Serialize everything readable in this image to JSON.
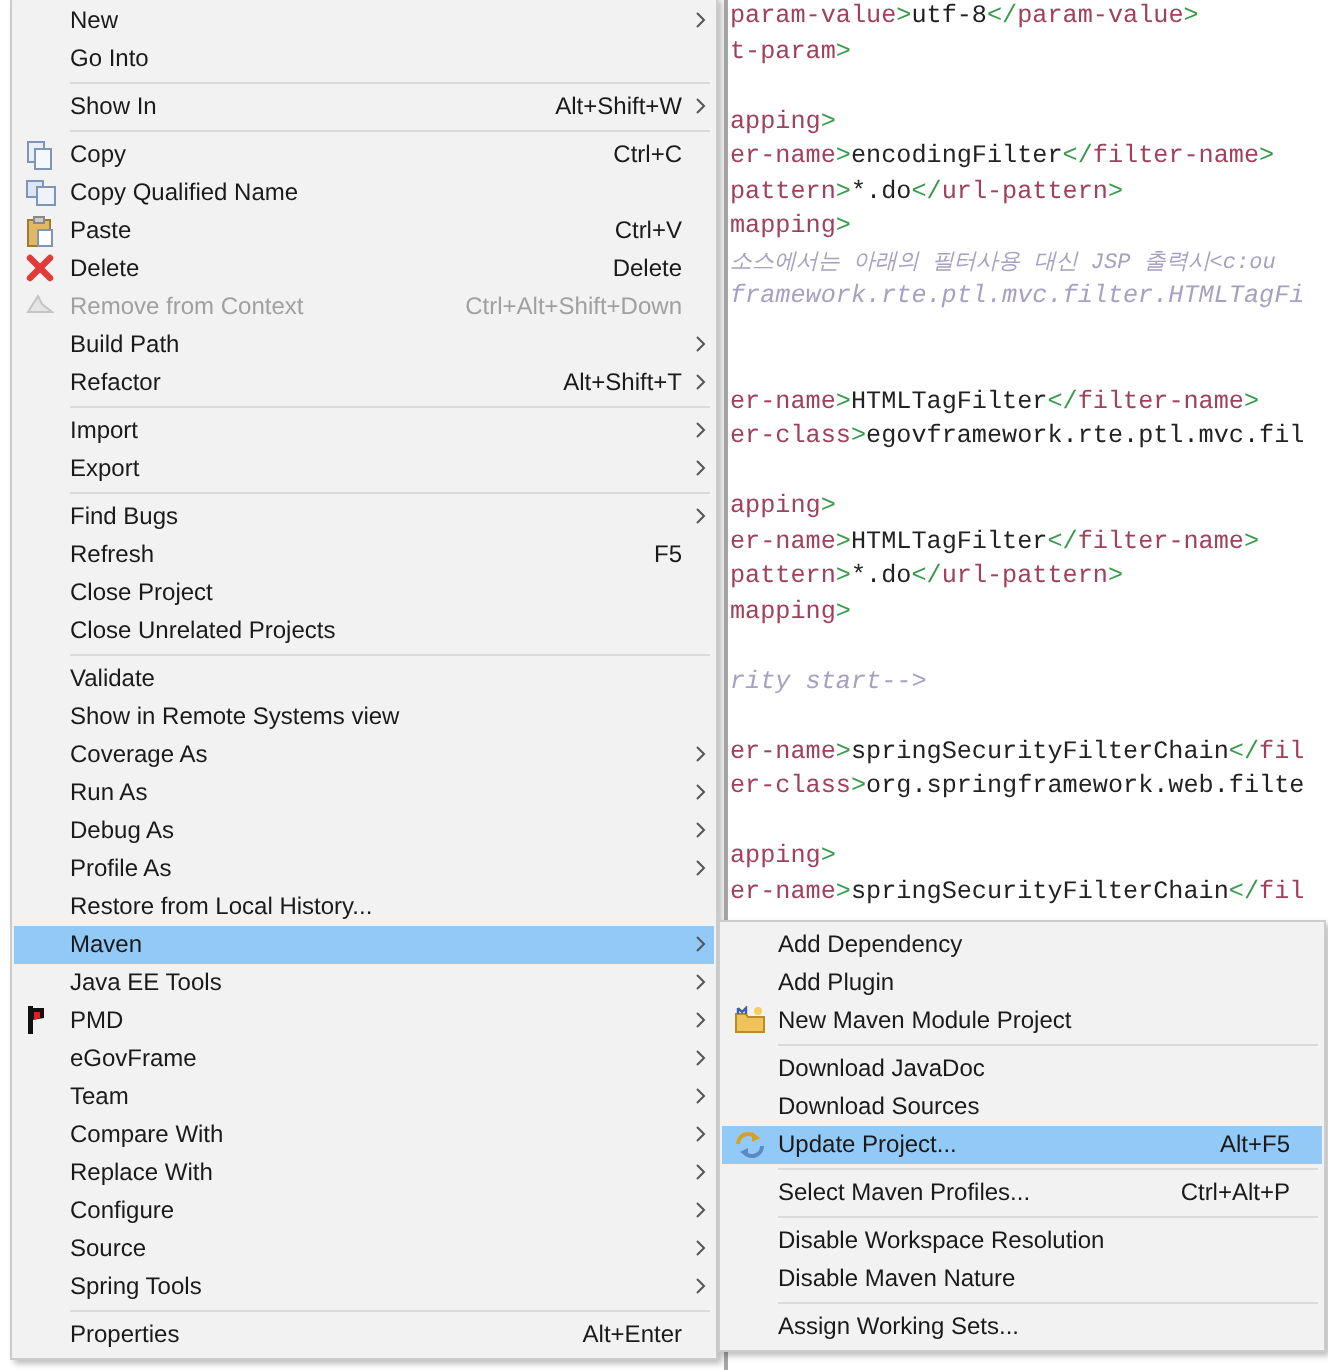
{
  "editor": {
    "lines": [
      {
        "kind": "code",
        "segments": [
          {
            "kind": "tag",
            "text": "param-value"
          },
          {
            "kind": "bracket",
            "text": ">"
          },
          {
            "kind": "text",
            "text": "utf-8"
          },
          {
            "kind": "bracket",
            "text": "</"
          },
          {
            "kind": "tag",
            "text": "param-value"
          },
          {
            "kind": "bracket",
            "text": ">"
          }
        ]
      },
      {
        "kind": "code",
        "segments": [
          {
            "kind": "tag",
            "text": "t-param"
          },
          {
            "kind": "bracket",
            "text": ">"
          }
        ]
      },
      {
        "kind": "blank"
      },
      {
        "kind": "code",
        "segments": [
          {
            "kind": "tag",
            "text": "apping"
          },
          {
            "kind": "bracket",
            "text": ">"
          }
        ]
      },
      {
        "kind": "code",
        "segments": [
          {
            "kind": "tag",
            "text": "er-name"
          },
          {
            "kind": "bracket",
            "text": ">"
          },
          {
            "kind": "text",
            "text": "encodingFilter"
          },
          {
            "kind": "bracket",
            "text": "</"
          },
          {
            "kind": "tag",
            "text": "filter-name"
          },
          {
            "kind": "bracket",
            "text": ">"
          }
        ]
      },
      {
        "kind": "code",
        "segments": [
          {
            "kind": "tag",
            "text": "pattern"
          },
          {
            "kind": "bracket",
            "text": ">"
          },
          {
            "kind": "text",
            "text": "*.do"
          },
          {
            "kind": "bracket",
            "text": "</"
          },
          {
            "kind": "tag",
            "text": "url-pattern"
          },
          {
            "kind": "bracket",
            "text": ">"
          }
        ]
      },
      {
        "kind": "code",
        "segments": [
          {
            "kind": "tag",
            "text": "mapping"
          },
          {
            "kind": "bracket",
            "text": ">"
          }
        ]
      },
      {
        "kind": "code",
        "segments": [
          {
            "kind": "hangul_comment",
            "text": "소스에서는 아래의 필터사용 대신 JSP 출력시<c:ou"
          }
        ]
      },
      {
        "kind": "code",
        "segments": [
          {
            "kind": "comment",
            "text": "framework.rte.ptl.mvc.filter.HTMLTagFi"
          }
        ]
      },
      {
        "kind": "blank"
      },
      {
        "kind": "blank"
      },
      {
        "kind": "code",
        "segments": [
          {
            "kind": "tag",
            "text": "er-name"
          },
          {
            "kind": "bracket",
            "text": ">"
          },
          {
            "kind": "text",
            "text": "HTMLTagFilter"
          },
          {
            "kind": "bracket",
            "text": "</"
          },
          {
            "kind": "tag",
            "text": "filter-name"
          },
          {
            "kind": "bracket",
            "text": ">"
          }
        ]
      },
      {
        "kind": "code",
        "segments": [
          {
            "kind": "tag",
            "text": "er-class"
          },
          {
            "kind": "bracket",
            "text": ">"
          },
          {
            "kind": "text",
            "text": "egovframework.rte.ptl.mvc.fil"
          }
        ]
      },
      {
        "kind": "blank"
      },
      {
        "kind": "code",
        "segments": [
          {
            "kind": "tag",
            "text": "apping"
          },
          {
            "kind": "bracket",
            "text": ">"
          }
        ]
      },
      {
        "kind": "code",
        "segments": [
          {
            "kind": "tag",
            "text": "er-name"
          },
          {
            "kind": "bracket",
            "text": ">"
          },
          {
            "kind": "text",
            "text": "HTMLTagFilter"
          },
          {
            "kind": "bracket",
            "text": "</"
          },
          {
            "kind": "tag",
            "text": "filter-name"
          },
          {
            "kind": "bracket",
            "text": ">"
          }
        ]
      },
      {
        "kind": "code",
        "segments": [
          {
            "kind": "tag",
            "text": "pattern"
          },
          {
            "kind": "bracket",
            "text": ">"
          },
          {
            "kind": "text",
            "text": "*.do"
          },
          {
            "kind": "bracket",
            "text": "</"
          },
          {
            "kind": "tag",
            "text": "url-pattern"
          },
          {
            "kind": "bracket",
            "text": ">"
          }
        ]
      },
      {
        "kind": "code",
        "segments": [
          {
            "kind": "tag",
            "text": "mapping"
          },
          {
            "kind": "bracket",
            "text": ">"
          }
        ]
      },
      {
        "kind": "blank"
      },
      {
        "kind": "code",
        "segments": [
          {
            "kind": "comment",
            "text": "rity start-->"
          }
        ]
      },
      {
        "kind": "blank"
      },
      {
        "kind": "code",
        "segments": [
          {
            "kind": "tag",
            "text": "er-name"
          },
          {
            "kind": "bracket",
            "text": ">"
          },
          {
            "kind": "text",
            "text": "springSecurityFilterChain"
          },
          {
            "kind": "bracket",
            "text": "</"
          },
          {
            "kind": "tag",
            "text": "fil"
          }
        ]
      },
      {
        "kind": "code",
        "segments": [
          {
            "kind": "tag",
            "text": "er-class"
          },
          {
            "kind": "bracket",
            "text": ">"
          },
          {
            "kind": "text",
            "text": "org.springframework.web.filte"
          }
        ]
      },
      {
        "kind": "blank"
      },
      {
        "kind": "code",
        "segments": [
          {
            "kind": "tag",
            "text": "apping"
          },
          {
            "kind": "bracket",
            "text": ">"
          }
        ]
      },
      {
        "kind": "code",
        "segments": [
          {
            "kind": "tag",
            "text": "er-name"
          },
          {
            "kind": "bracket",
            "text": ">"
          },
          {
            "kind": "text",
            "text": "springSecurityFilterChain"
          },
          {
            "kind": "bracket",
            "text": "</"
          },
          {
            "kind": "tag",
            "text": "fil"
          }
        ]
      }
    ]
  },
  "context_menu": {
    "entries": [
      {
        "kind": "item",
        "label": "New",
        "submenu": true,
        "disabled": false,
        "selected": false
      },
      {
        "kind": "item",
        "label": "Go Into",
        "submenu": false,
        "disabled": false,
        "selected": false
      },
      {
        "kind": "separator"
      },
      {
        "kind": "item",
        "label": "Show In",
        "shortcut": "Alt+Shift+W",
        "submenu": true,
        "disabled": false,
        "selected": false
      },
      {
        "kind": "separator"
      },
      {
        "kind": "item",
        "label": "Copy",
        "shortcut": "Ctrl+C",
        "submenu": false,
        "disabled": false,
        "selected": false
      },
      {
        "kind": "item",
        "label": "Copy Qualified Name",
        "submenu": false,
        "disabled": false,
        "selected": false
      },
      {
        "kind": "item",
        "label": "Paste",
        "shortcut": "Ctrl+V",
        "submenu": false,
        "disabled": false,
        "selected": false
      },
      {
        "kind": "item",
        "label": "Delete",
        "shortcut": "Delete",
        "submenu": false,
        "disabled": false,
        "selected": false
      },
      {
        "kind": "item",
        "label": "Remove from Context",
        "shortcut": "Ctrl+Alt+Shift+Down",
        "submenu": false,
        "disabled": true,
        "selected": false
      },
      {
        "kind": "item",
        "label": "Build Path",
        "submenu": true,
        "disabled": false,
        "selected": false
      },
      {
        "kind": "item",
        "label": "Refactor",
        "shortcut": "Alt+Shift+T",
        "submenu": true,
        "disabled": false,
        "selected": false
      },
      {
        "kind": "separator"
      },
      {
        "kind": "item",
        "label": "Import",
        "submenu": true,
        "disabled": false,
        "selected": false
      },
      {
        "kind": "item",
        "label": "Export",
        "submenu": true,
        "disabled": false,
        "selected": false
      },
      {
        "kind": "separator"
      },
      {
        "kind": "item",
        "label": "Find Bugs",
        "submenu": true,
        "disabled": false,
        "selected": false
      },
      {
        "kind": "item",
        "label": "Refresh",
        "shortcut": "F5",
        "submenu": false,
        "disabled": false,
        "selected": false
      },
      {
        "kind": "item",
        "label": "Close Project",
        "submenu": false,
        "disabled": false,
        "selected": false
      },
      {
        "kind": "item",
        "label": "Close Unrelated Projects",
        "submenu": false,
        "disabled": false,
        "selected": false
      },
      {
        "kind": "separator"
      },
      {
        "kind": "item",
        "label": "Validate",
        "submenu": false,
        "disabled": false,
        "selected": false
      },
      {
        "kind": "item",
        "label": "Show in Remote Systems view",
        "submenu": false,
        "disabled": false,
        "selected": false
      },
      {
        "kind": "item",
        "label": "Coverage As",
        "submenu": true,
        "disabled": false,
        "selected": false
      },
      {
        "kind": "item",
        "label": "Run As",
        "submenu": true,
        "disabled": false,
        "selected": false
      },
      {
        "kind": "item",
        "label": "Debug As",
        "submenu": true,
        "disabled": false,
        "selected": false
      },
      {
        "kind": "item",
        "label": "Profile As",
        "submenu": true,
        "disabled": false,
        "selected": false
      },
      {
        "kind": "item",
        "label": "Restore from Local History...",
        "submenu": false,
        "disabled": false,
        "selected": false
      },
      {
        "kind": "item",
        "label": "Maven",
        "submenu": true,
        "disabled": false,
        "selected": true
      },
      {
        "kind": "item",
        "label": "Java EE Tools",
        "submenu": true,
        "disabled": false,
        "selected": false
      },
      {
        "kind": "item",
        "label": "PMD",
        "submenu": true,
        "disabled": false,
        "selected": false
      },
      {
        "kind": "item",
        "label": "eGovFrame",
        "submenu": true,
        "disabled": false,
        "selected": false
      },
      {
        "kind": "item",
        "label": "Team",
        "submenu": true,
        "disabled": false,
        "selected": false
      },
      {
        "kind": "item",
        "label": "Compare With",
        "submenu": true,
        "disabled": false,
        "selected": false
      },
      {
        "kind": "item",
        "label": "Replace With",
        "submenu": true,
        "disabled": false,
        "selected": false
      },
      {
        "kind": "item",
        "label": "Configure",
        "submenu": true,
        "disabled": false,
        "selected": false
      },
      {
        "kind": "item",
        "label": "Source",
        "submenu": true,
        "disabled": false,
        "selected": false
      },
      {
        "kind": "item",
        "label": "Spring Tools",
        "submenu": true,
        "disabled": false,
        "selected": false
      },
      {
        "kind": "separator"
      },
      {
        "kind": "item",
        "label": "Properties",
        "shortcut": "Alt+Enter",
        "submenu": false,
        "disabled": false,
        "selected": false
      }
    ]
  },
  "maven_submenu": {
    "entries": [
      {
        "kind": "item",
        "label": "Add Dependency",
        "submenu": false,
        "disabled": false,
        "selected": false
      },
      {
        "kind": "item",
        "label": "Add Plugin",
        "submenu": false,
        "disabled": false,
        "selected": false
      },
      {
        "kind": "item",
        "label": "New Maven Module Project",
        "submenu": false,
        "disabled": false,
        "selected": false
      },
      {
        "kind": "separator"
      },
      {
        "kind": "item",
        "label": "Download JavaDoc",
        "submenu": false,
        "disabled": false,
        "selected": false
      },
      {
        "kind": "item",
        "label": "Download Sources",
        "submenu": false,
        "disabled": false,
        "selected": false
      },
      {
        "kind": "item",
        "label": "Update Project...",
        "shortcut": "Alt+F5",
        "submenu": false,
        "disabled": false,
        "selected": true
      },
      {
        "kind": "separator"
      },
      {
        "kind": "item",
        "label": "Select Maven Profiles...",
        "shortcut": "Ctrl+Alt+P",
        "submenu": false,
        "disabled": false,
        "selected": false
      },
      {
        "kind": "separator"
      },
      {
        "kind": "item",
        "label": "Disable Workspace Resolution",
        "submenu": false,
        "disabled": false,
        "selected": false
      },
      {
        "kind": "item",
        "label": "Disable Maven Nature",
        "submenu": false,
        "disabled": false,
        "selected": false
      },
      {
        "kind": "separator"
      },
      {
        "kind": "item",
        "label": "Assign Working Sets...",
        "submenu": false,
        "disabled": false,
        "selected": false
      }
    ]
  }
}
